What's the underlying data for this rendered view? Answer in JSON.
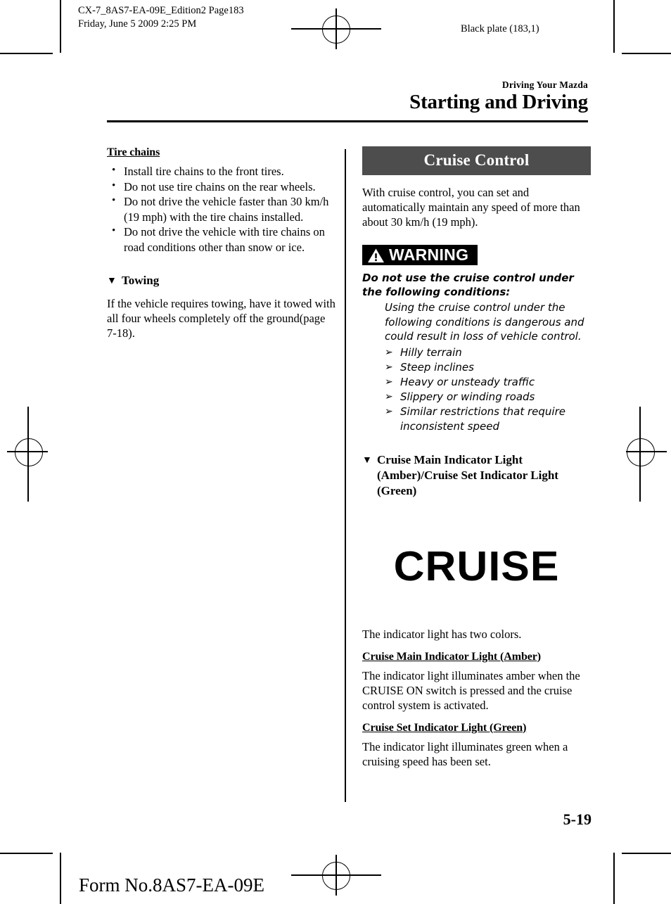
{
  "print_marks": {
    "job_info": "CX-7_8AS7-EA-09E_Edition2 Page183\nFriday, June 5 2009 2:25 PM",
    "black_plate": "Black plate (183,1)"
  },
  "header": {
    "kicker": "Driving Your Mazda",
    "title": "Starting and Driving"
  },
  "left_column": {
    "tire_chains": {
      "heading": "Tire chains",
      "bullets": [
        "Install tire chains to the front tires.",
        "Do not use tire chains on the rear wheels.",
        "Do not drive the vehicle faster than 30 km/h (19 mph) with the tire chains installed.",
        "Do not drive the vehicle with tire chains on road conditions other than snow or ice."
      ]
    },
    "towing": {
      "heading": "Towing",
      "body": "If the vehicle requires towing, have it towed with all four wheels completely off the ground(page 7-18)."
    }
  },
  "right_column": {
    "section_title": "Cruise Control",
    "intro": "With cruise control, you can set and automatically maintain any speed of more than about 30 km/h (19 mph).",
    "warning": {
      "label": "WARNING",
      "icon": "warning-triangle-icon",
      "lead": "Do not use the cruise control under the following conditions:",
      "body": "Using the cruise control under the following conditions is dangerous and could result in loss of vehicle control.",
      "items": [
        "Hilly terrain",
        "Steep inclines",
        "Heavy or unsteady traffic",
        "Slippery or winding roads",
        "Similar restrictions that require inconsistent speed"
      ]
    },
    "indicator_heading": "Cruise Main Indicator Light (Amber)/Cruise Set Indicator Light (Green)",
    "indicator_graphic": "CRUISE",
    "colors_note": "The indicator light has two colors.",
    "amber": {
      "heading": "Cruise Main Indicator Light (Amber)",
      "body": "The indicator light illuminates amber when the CRUISE ON switch is pressed and the cruise control system is activated."
    },
    "green": {
      "heading": "Cruise Set Indicator Light (Green)",
      "body": "The indicator light illuminates green when a cruising speed has been set."
    }
  },
  "footer": {
    "page_number": "5-19",
    "form_number": "Form No.8AS7-EA-09E"
  }
}
